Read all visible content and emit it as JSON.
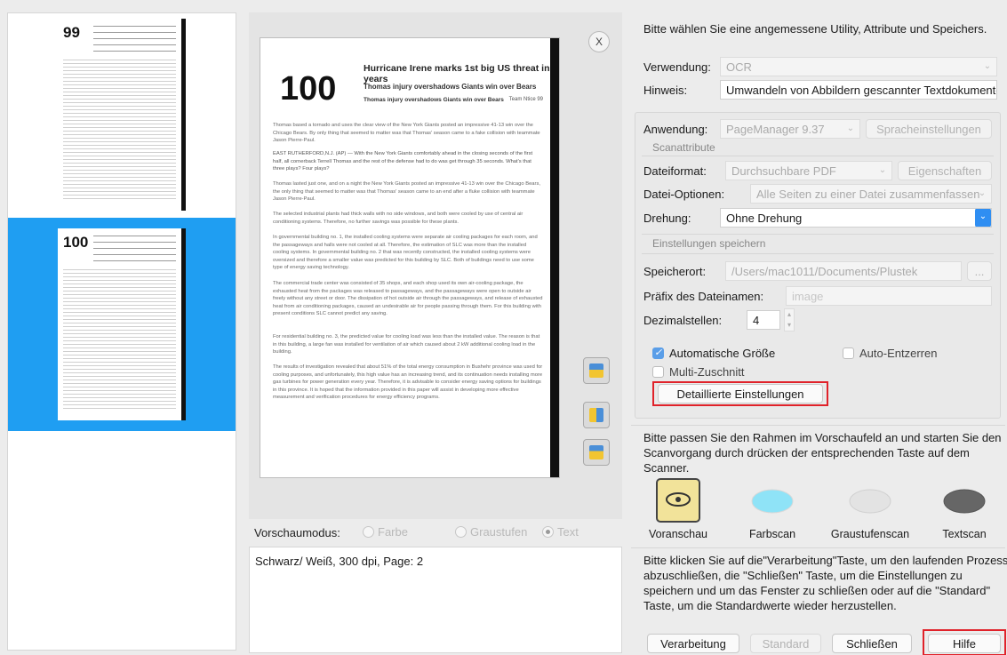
{
  "thumbnails": [
    {
      "number": "99",
      "selected": false
    },
    {
      "number": "100",
      "selected": true
    }
  ],
  "preview": {
    "page_number": "100",
    "headline": "Hurricane Irene marks 1st big US threat in years",
    "subhead1": "Thomas injury overshadows Giants win over Bears",
    "subhead2": "Thomas injury overshadows Giants win over Bears",
    "byline": "Team Ntice 99",
    "lead": "Thomas based a tornado and uses the clear view of the New York Giants posted an impressive 41-13 win over the Chicago Bears. By only thing that seemed to matter was that Thomas' season came to a fake collision with teammate Jason Pierre-Paul.",
    "p1": "EAST RUTHERFORD,N.J. (AP) — With the New York Giants comfortably ahead in the closing seconds of the first half, all cornerback Terrell Thomas and the rest of the defense had to do was get through 35 seconds. What's that three plays? Four plays?",
    "p2": "Thomas lasted just one, and on a night the New York Giants posted an impressive 41-13 win over the Chicago Bears, the only thing that seemed to matter was that Thomas' season came to an end after a fluke collision with teammate Jason Pierre-Paul.",
    "p3": "The selected industrial plants had thick walls with no side windows, and both were cooled by use of central air conditioning systems. Therefore, no further savings was possible for these plants.",
    "p4": "In governmental building no. 1, the installed cooling systems were separate air cooling packages for each room, and the passageways and halls were not cooled at all. Therefore, the estimation of SLC was more than the installed cooling systems. In governmental building no. 2 that was recently constructed, the installed cooling systems were oversized and therefore a smaller value was predicted for this building by SLC. Both of buildings need to use some type of energy saving technology.",
    "p5": "The commercial trade center was consisted of 35 shops, and each shop used its own air-cooling package, the exhausted heat from the packages was released to passageways, and the passageways were open to outside air freely without any street or door. The dissipation of hot outside air through the passageways, and release of exhausted heat from air conditioning packages, caused an undesirable air for people passing through them. For this building with present conditions SLC cannot predict any saving.",
    "p6": "For residential building no. 3, the predicted value for cooling load was less than the installed value. The reason is that in this building, a large fan was installed for ventilation of air which caused about 2 kW additional cooling load in the building.",
    "p7": "The results of investigation revealed that about 51% of the total energy consumption in Bushehr province was used for cooling purposes, and unfortunately, this high value has an increasing trend, and its continuation needs installing more gas turbines for power generation every year. Therefore, it is advisable to consider energy saving options for buildings in this province. It is hoped that the information provided in this paper will assist in developing more effective measurement and verification procedures for energy efficiency programs."
  },
  "close_label": "X",
  "preview_mode": {
    "label": "Vorschaumodus:",
    "options": [
      "Farbe",
      "Graustufen",
      "Text"
    ],
    "selected": "Text"
  },
  "status": "Schwarz/ Weiß, 300 dpi, Page: 2",
  "settings": {
    "intro": "Bitte wählen Sie eine angemessene Utility, Attribute und Speichers.",
    "verwendung_label": "Verwendung:",
    "verwendung_value": "OCR",
    "hinweis_label": "Hinweis:",
    "hinweis_value": "Umwandeln von Abbildern gescannter Textdokumente",
    "anwendung_label": "Anwendung:",
    "anwendung_value": "PageManager 9.37",
    "sprache_button": "Spracheinstellungen",
    "scanattribute": "Scanattribute",
    "dateiformat_label": "Dateiformat:",
    "dateiformat_value": "Durchsuchbare PDF",
    "eigenschaften_button": "Eigenschaften",
    "optionen_label": "Datei-Optionen:",
    "optionen_value": "Alle Seiten zu einer Datei zusammenfassen",
    "drehung_label": "Drehung:",
    "drehung_value": "Ohne Drehung",
    "speichern_header": "Einstellungen speichern",
    "speicherort_label": "Speicherort:",
    "speicherort_value": "/Users/mac1011/Documents/Plustek",
    "browse_button": "...",
    "praefix_label": "Präfix des Dateinamen:",
    "praefix_placeholder": "image",
    "dezimal_label": "Dezimalstellen:",
    "dezimal_value": "4",
    "auto_groesse": "Automatische Größe",
    "auto_entzerren": "Auto-Entzerren",
    "multi_zuschnitt": "Multi-Zuschnitt",
    "detail_button": "Detaillierte Einstellungen"
  },
  "scan": {
    "intro": "Bitte passen Sie den Rahmen im Vorschaufeld an und starten Sie den Scanvorgang durch drücken der entsprechenden Taste auf dem Scanner.",
    "buttons": [
      "Voranschau",
      "Farbscan",
      "Graustufenscan",
      "Textscan"
    ]
  },
  "footer": {
    "text": "Bitte klicken Sie auf die\"Verarbeitung\"Taste, um den laufenden Prozess abzuschließen, die \"Schließen\" Taste, um die Einstellungen zu speichern und um das Fenster zu schließen oder auf die \"Standard\" Taste, um die Standardwerte wieder herzustellen.",
    "verarbeitung": "Verarbeitung",
    "standard": "Standard",
    "schliessen": "Schließen",
    "hilfe": "Hilfe"
  },
  "colors": {
    "selection": "#1f9ef2",
    "highlight": "#e0222a",
    "checkbox": "#5a9ee8"
  }
}
